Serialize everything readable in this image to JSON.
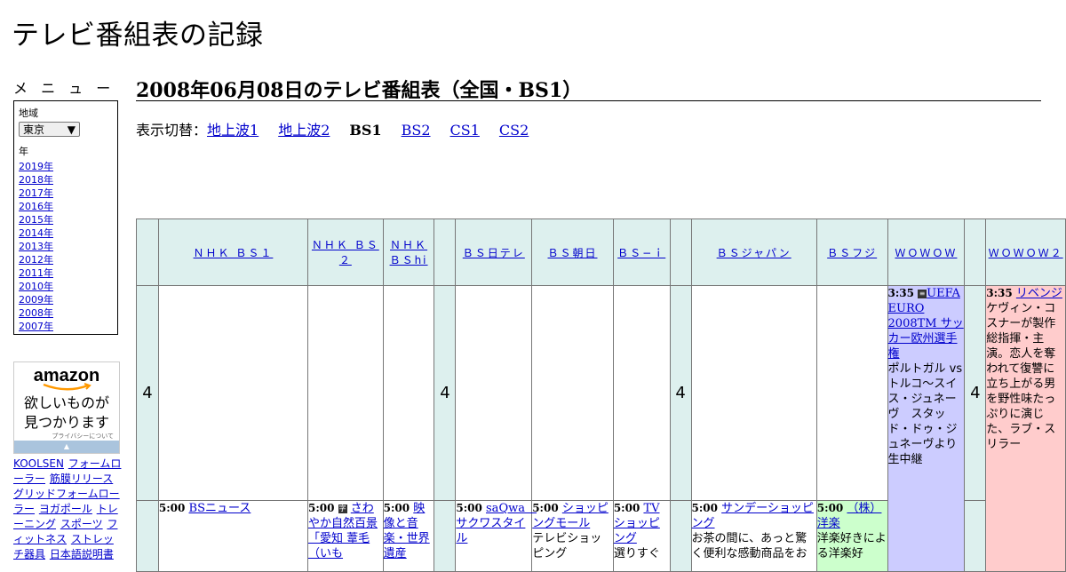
{
  "site": {
    "title": "テレビ番組表の記録"
  },
  "menu": {
    "heading": "メ ニ ュ ー",
    "region_label": "地域",
    "region_value": "東京",
    "year_label": "年",
    "years": [
      "2019年",
      "2018年",
      "2017年",
      "2016年",
      "2015年",
      "2014年",
      "2013年",
      "2012年",
      "2011年",
      "2010年",
      "2009年",
      "2008年",
      "2007年"
    ]
  },
  "ad": {
    "logo": "amazon",
    "tagline_1": "欲しいものが",
    "tagline_2": "見つかります",
    "privacy": "プライバシーについて"
  },
  "keywords": [
    "KOOLSEN",
    "フォームローラー",
    "筋膜リリース",
    "グリッドフォームローラー",
    "ヨガポール",
    "トレーニング",
    "スポーツ",
    "フィットネス",
    "ストレッチ器具",
    "日本語説明書"
  ],
  "main": {
    "title": "2008年06月08日のテレビ番組表（全国・BS1）",
    "switch_label": "表示切替：",
    "switch_items": [
      {
        "label": "地上波1",
        "link": true
      },
      {
        "label": "地上波2",
        "link": true
      },
      {
        "label": "BS1",
        "link": false
      },
      {
        "label": "BS2",
        "link": true
      },
      {
        "label": "CS1",
        "link": true
      },
      {
        "label": "CS2",
        "link": true
      }
    ]
  },
  "schedule": {
    "hour": "4",
    "channels": [
      "ＮＨＫ ＢＳ１",
      "ＮＨＫ ＢＳ２",
      "ＮＨＫ ＢＳhi",
      "ＢＳ日テレ",
      "ＢＳ朝日",
      "ＢＳ−ｉ",
      "ＢＳジャパン",
      "ＢＳフジ",
      "ＷＯＷＯＷ",
      "ＷＯＷＯＷ２"
    ],
    "wowow_435": {
      "time": "3:35",
      "title": "UEFA EURO 2008TM サッカー欧州選手権",
      "desc": "ポルトガル vs トルコ～スイス・ジュネーヴ　スタッド・ドゥ・ジュネーヴより生中継"
    },
    "wowow2_335": {
      "time": "3:35",
      "title": "リベンジ",
      "desc": "ケヴィン・コスナーが製作総指揮・主演。恋人を奪われて復讐に立ち上がる男を野性味たっぷりに演じた、ラブ・スリラー"
    },
    "row5": [
      {
        "time": "5:00",
        "title": "BSニュース",
        "desc": ""
      },
      {
        "time": "5:00",
        "icon": "字",
        "title": "さわやか自然百景「愛知 葦毛（いも",
        "desc": ""
      },
      {
        "time": "5:00",
        "title": "映像と音楽・世界遺産",
        "desc": ""
      },
      {
        "time": "5:00",
        "title": "saQwa　サクワスタイル",
        "desc": ""
      },
      {
        "time": "5:00",
        "title": "ショッピングモール",
        "desc": "テレビショッピング"
      },
      {
        "time": "5:00",
        "title": "TVショッピング",
        "desc": "選りすぐ"
      },
      {
        "time": "5:00",
        "title": "サンデーショッピング",
        "desc": "お茶の間に、あっと驚く便利な感動商品をお"
      },
      {
        "time": "5:00",
        "title": "（株）洋楽",
        "desc": "洋楽好きによる洋楽好"
      }
    ]
  }
}
